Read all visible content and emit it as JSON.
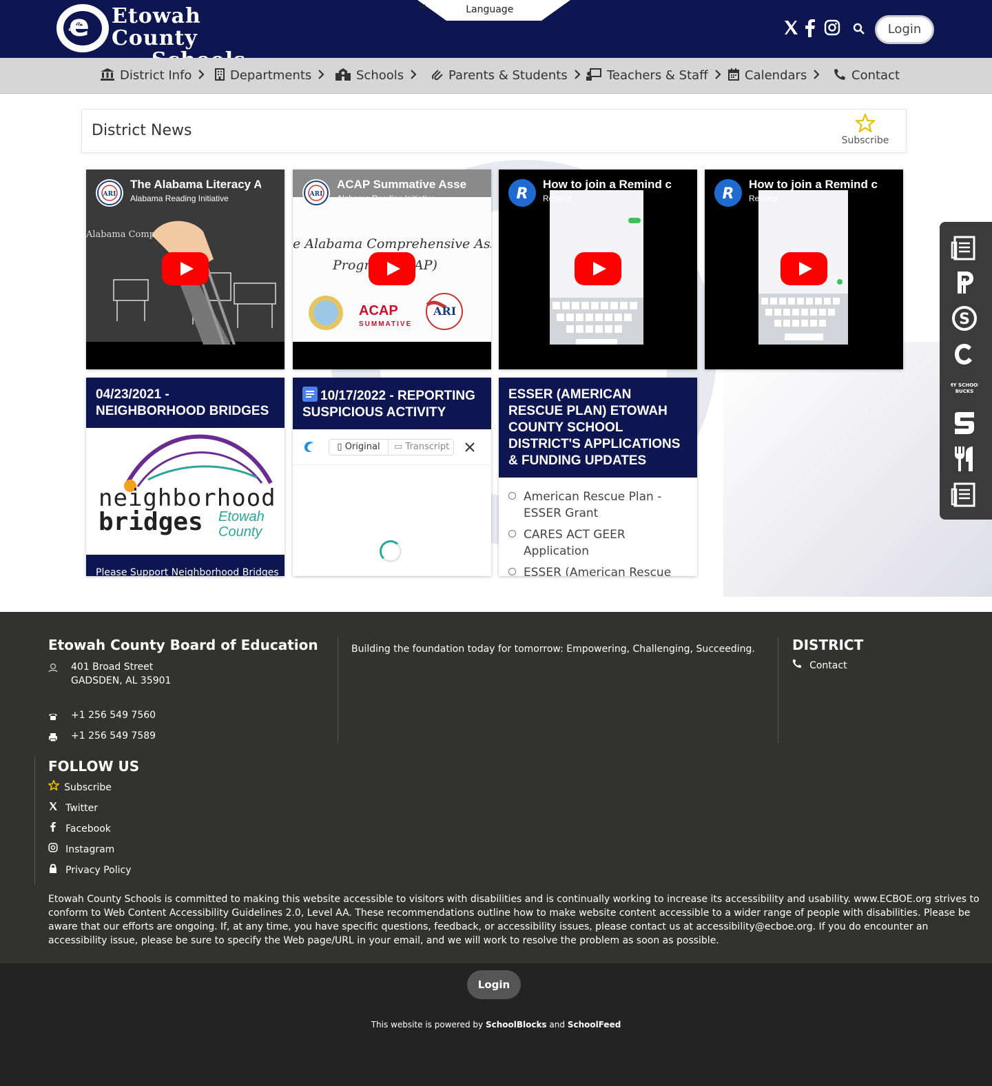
{
  "header": {
    "logo_line1": "Etowah County",
    "logo_line2": "Schools",
    "logo_badge": "ecboe",
    "logo_letter": "e",
    "language_label": "Language",
    "login_label": "Login"
  },
  "nav": {
    "items": [
      {
        "label": "District Info",
        "icon": "building-columns-icon",
        "chevron": true
      },
      {
        "label": "Departments",
        "icon": "building-icon",
        "chevron": true
      },
      {
        "label": "Schools",
        "icon": "school-icon",
        "chevron": true
      },
      {
        "label": "Parents & Students",
        "icon": "paperclip-icon",
        "chevron": true
      },
      {
        "label": "Teachers & Staff",
        "icon": "chalkboard-teacher-icon",
        "chevron": true
      },
      {
        "label": "Calendars",
        "icon": "calendar-icon",
        "chevron": true
      },
      {
        "label": "Contact",
        "icon": "phone-icon",
        "chevron": false
      }
    ]
  },
  "news": {
    "title": "District News",
    "subscribe_label": "Subscribe",
    "videos": [
      {
        "title": "The Alabama Literacy A",
        "channel": "Alabama Reading Initiative",
        "caption": "Alabama Comp"
      },
      {
        "title": "ACAP Summative Asse",
        "channel": "Alabama Reading Initiative",
        "caption": "e Alabama Comprehensive Assessment",
        "caption2": "Progra",
        "caption3": "AP)",
        "logo_text": "ACAP",
        "logo_sub": "SUMMATIVE",
        "badge": "ARI"
      },
      {
        "title": "How to join a Remind c",
        "channel": "Remind"
      },
      {
        "title": "How to join a Remind c",
        "channel": "Remind"
      }
    ],
    "posts": [
      {
        "heading": "04/23/2021 - NEIGHBORHOOD BRIDGES",
        "logo_line1": "neighborhood",
        "logo_line2": "bridges",
        "logo_line3": "Etowah",
        "logo_line4": "County",
        "footer_text": "Please Support Neighborhood Bridges"
      },
      {
        "heading": "10/17/2022 - REPORTING SUSPICIOUS ACTIVITY",
        "tab_original": "Original",
        "tab_transcript": "Transcript"
      },
      {
        "heading": "ESSER (AMERICAN RESCUE PLAN) ETOWAH COUNTY SCHOOL DISTRICT'S APPLICATIONS & FUNDING UPDATES",
        "items": [
          "American Rescue Plan - ESSER Grant",
          "CARES ACT GEER Application",
          "ESSER (American Rescue Plan) Etowah County School"
        ]
      }
    ]
  },
  "side_rail": {
    "icons": [
      "newspaper-icon",
      "powerschool-p-icon",
      "dollar-circle-icon",
      "canvas-c-icon",
      "myschoolbucks-icon",
      "schoolfeed-s-icon",
      "fork-knife-icon",
      "menu-document-icon"
    ],
    "msb_text": "MY SCHOOL BUCKS"
  },
  "footer": {
    "org_name": "Etowah County Board of Education",
    "address_line1": "401 Broad Street",
    "address_line2": "GADSDEN, AL 35901",
    "phone": "+1 256 549 7560",
    "fax": "+1 256 549 7589",
    "tagline": "Building the foundation today for tomorrow: Empowering, Challenging, Succeeding.",
    "district_heading": "DISTRICT",
    "district_contact": "Contact",
    "follow_heading": "FOLLOW US",
    "follow_links": [
      "Subscribe",
      "Twitter",
      "Facebook",
      "Instagram",
      "Privacy Policy"
    ],
    "accessibility": "Etowah County Schools is committed to making this website accessible to visitors with disabilities and is continually working to increase its accessibility and usability. www.ECBOE.org strives to conform to Web Content Accessibility Guidelines 2.0, Level AA. These recommendations outline how to make website content accessible to a wider range of people with disabilities. Please be aware that our efforts are ongoing. If, at any time, you have specific questions, feedback, or accessibility issues, please contact us at accessibility@ecboe.org. If you do encounter an accessibility issue, please be sure to specify the Web page/URL in your email, and we will work to resolve the problem as soon as possible.",
    "login_label": "Login",
    "powered_prefix": "This website is powered by",
    "powered_brand1": "SchoolBlocks",
    "powered_and": "and",
    "powered_brand2": "SchoolFeed"
  },
  "colors": {
    "brand_navy": "#0d1650",
    "nav_gray": "#d6d6d6",
    "footer_dark": "#323230",
    "youtube_red": "#ff0000",
    "subscribe_star": "#e5c100"
  }
}
